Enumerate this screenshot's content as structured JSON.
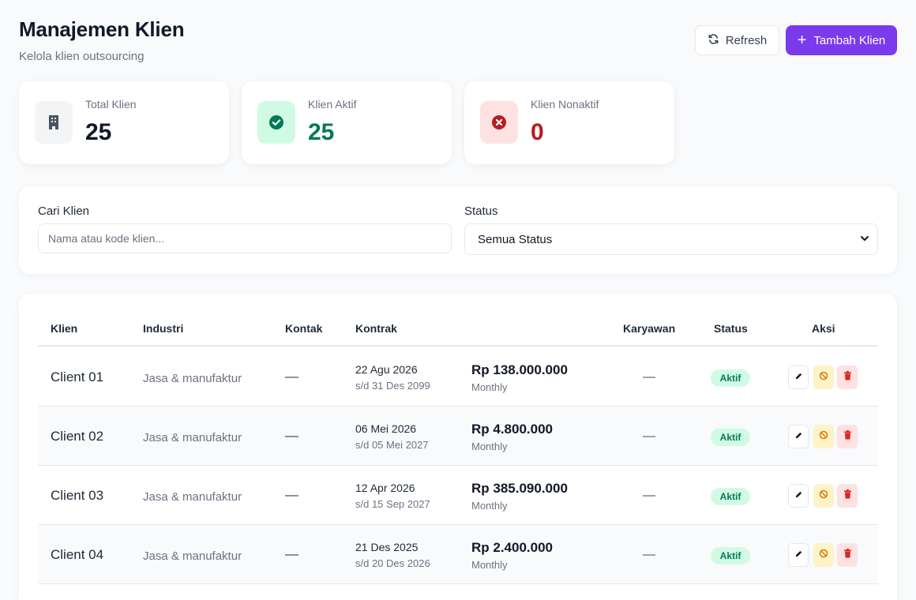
{
  "header": {
    "title": "Manajemen Klien",
    "subtitle": "Kelola klien outsourcing",
    "refresh_label": "Refresh",
    "add_label": "Tambah Klien"
  },
  "stats": [
    {
      "label": "Total Klien",
      "value": "25",
      "icon": "building-icon",
      "color": "#111827",
      "icon_bg": "#f3f4f6"
    },
    {
      "label": "Klien Aktif",
      "value": "25",
      "icon": "check-circle-icon",
      "color": "#047857",
      "icon_bg": "#d1fae5"
    },
    {
      "label": "Klien Nonaktif",
      "value": "0",
      "icon": "x-circle-icon",
      "color": "#b91c1c",
      "icon_bg": "#fee2e2"
    }
  ],
  "filters": {
    "search_label": "Cari Klien",
    "search_placeholder": "Nama atau kode klien...",
    "search_value": "",
    "status_label": "Status",
    "status_value": "Semua Status"
  },
  "table": {
    "headers": [
      "Klien",
      "Industri",
      "Kontak",
      "Kontrak",
      "Karyawan",
      "Status",
      "Aksi"
    ],
    "rows": [
      {
        "name": "Client 01",
        "industry": "Jasa & manufaktur",
        "contact": "—",
        "start": "22 Agu 2026",
        "end": "s/d 31 Des 2099",
        "amount": "Rp 138.000.000",
        "period": "Monthly",
        "status": "Aktif"
      },
      {
        "name": "Client 02",
        "industry": "Jasa & manufaktur",
        "contact": "—",
        "start": "06 Mei 2026",
        "end": "s/d 05 Mei 2027",
        "amount": "Rp 4.800.000",
        "period": "Monthly",
        "status": "Aktif"
      },
      {
        "name": "Client 03",
        "industry": "Jasa & manufaktur",
        "contact": "—",
        "start": "12 Apr 2026",
        "end": "s/d 15 Sep 2027",
        "amount": "Rp 385.090.000",
        "period": "Monthly",
        "status": "Aktif"
      },
      {
        "name": "Client 04",
        "industry": "Jasa & manufaktur",
        "contact": "—",
        "start": "21 Des 2025",
        "end": "s/d 20 Des 2026",
        "amount": "Rp 2.400.000",
        "period": "Monthly",
        "status": "Aktif"
      }
    ]
  },
  "colors": {
    "accent": "#7c3aed",
    "active_badge_bg": "#d1fae5",
    "active_badge_text": "#047857",
    "danger": "#dc2626",
    "warning": "#d97706"
  }
}
